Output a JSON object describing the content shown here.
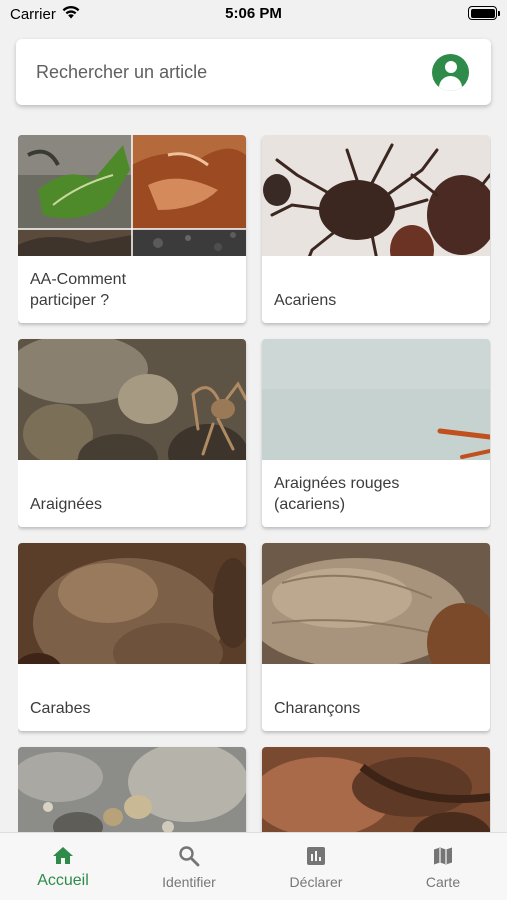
{
  "status_bar": {
    "carrier": "Carrier",
    "time": "5:06 PM"
  },
  "search": {
    "placeholder": "Rechercher un article",
    "value": "",
    "account_icon": "account-circle-icon"
  },
  "articles": [
    {
      "label": "AA-Comment\nparticiper ?"
    },
    {
      "label": "Acariens"
    },
    {
      "label": "Araignées"
    },
    {
      "label": "Araignées rouges\n(acariens)"
    },
    {
      "label": "Carabes"
    },
    {
      "label": "Charançons"
    },
    {
      "label": ""
    },
    {
      "label": ""
    }
  ],
  "tabs": [
    {
      "label": "Accueil",
      "icon": "home-icon",
      "active": true
    },
    {
      "label": "Identifier",
      "icon": "search-icon",
      "active": false
    },
    {
      "label": "Déclarer",
      "icon": "bar-chart-icon",
      "active": false
    },
    {
      "label": "Carte",
      "icon": "map-icon",
      "active": false
    }
  ],
  "colors": {
    "accent": "#2e8b4a",
    "inactive": "#777777",
    "background": "#f1f1f1"
  }
}
